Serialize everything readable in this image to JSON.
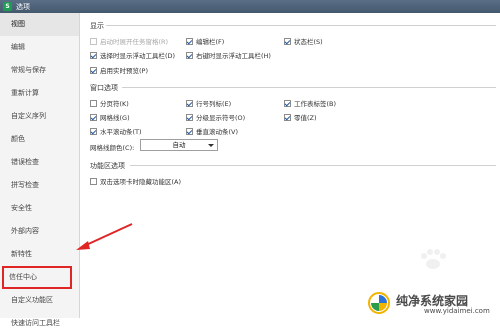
{
  "window": {
    "title": "选项",
    "logo_text": "S"
  },
  "sidebar": {
    "items": [
      {
        "label": "视图",
        "active": true
      },
      {
        "label": "编辑"
      },
      {
        "label": "常规与保存"
      },
      {
        "label": "重新计算"
      },
      {
        "label": "自定义序列"
      },
      {
        "label": "颜色"
      },
      {
        "label": "错误检查"
      },
      {
        "label": "拼写检查"
      },
      {
        "label": "安全性"
      },
      {
        "label": "外部内容"
      },
      {
        "label": "新特性"
      },
      {
        "label": "信任中心",
        "highlighted": true
      },
      {
        "label": "自定义功能区"
      },
      {
        "label": "快速访问工具栏"
      }
    ]
  },
  "display": {
    "title": "显示",
    "options": [
      {
        "label": "启动时展开任务窗格(R)",
        "checked": false,
        "disabled": true
      },
      {
        "label": "编辑栏(F)",
        "checked": true
      },
      {
        "label": "状态栏(S)",
        "checked": true
      },
      {
        "label": "选择时显示浮动工具栏(D)",
        "checked": true
      },
      {
        "label": "右键时显示浮动工具栏(H)",
        "checked": true
      },
      {
        "label": "启用实时预览(P)",
        "checked": true
      }
    ]
  },
  "window_options": {
    "title": "窗口选项",
    "options": [
      {
        "label": "分页符(K)",
        "checked": false
      },
      {
        "label": "行号列标(E)",
        "checked": true
      },
      {
        "label": "工作表标签(B)",
        "checked": true
      },
      {
        "label": "网格线(G)",
        "checked": true
      },
      {
        "label": "分级显示符号(O)",
        "checked": true
      },
      {
        "label": "零值(Z)",
        "checked": true
      },
      {
        "label": "水平滚动条(T)",
        "checked": true
      },
      {
        "label": "垂直滚动条(V)",
        "checked": true
      }
    ],
    "gridline_color_label": "网格线颜色(C):",
    "gridline_color_value": "自动"
  },
  "ribbon": {
    "title": "功能区选项",
    "options": [
      {
        "label": "双击选项卡时隐藏功能区(A)",
        "checked": false
      }
    ]
  },
  "watermark": {
    "text": "纯净系统家园",
    "url": "www.yidaimei.com"
  },
  "colors": {
    "highlight_border": "#e02525",
    "arrow": "#e02525",
    "check": "#1a55a8"
  }
}
